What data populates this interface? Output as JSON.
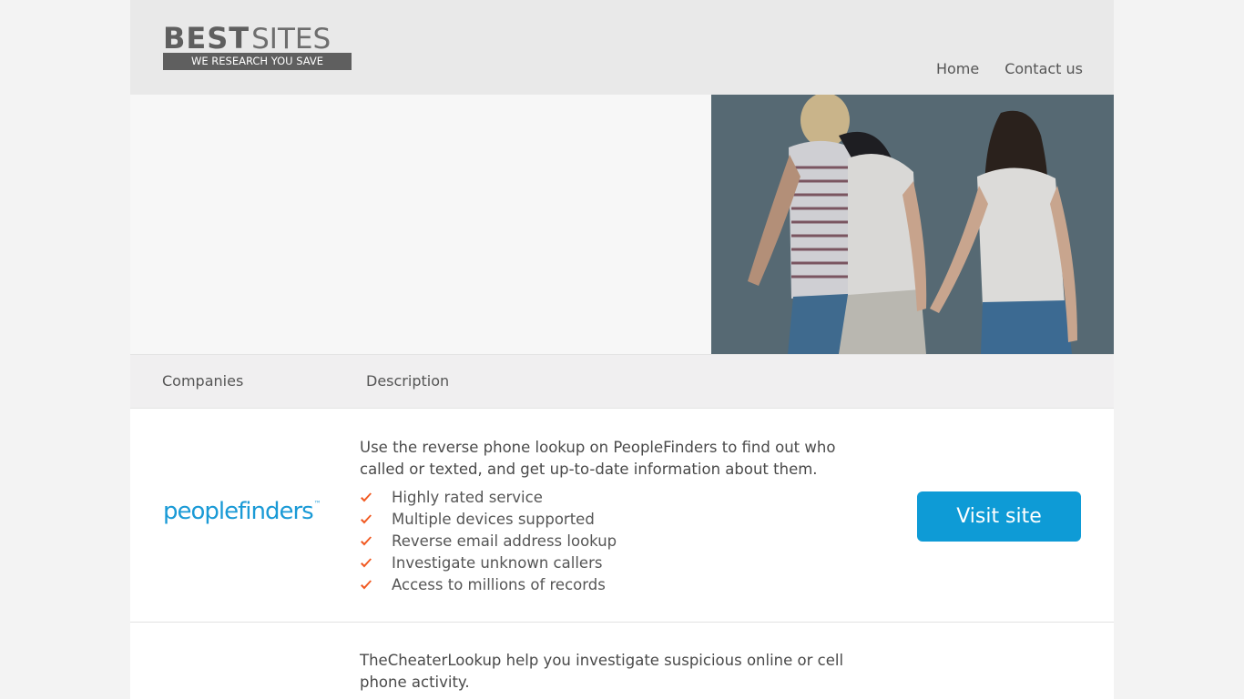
{
  "header": {
    "logo_bold": "BEST",
    "logo_light": "SITES",
    "logo_tagline": "WE RESEARCH YOU SAVE",
    "nav": {
      "home": "Home",
      "contact": "Contact us"
    }
  },
  "table": {
    "col_companies": "Companies",
    "col_description": "Description"
  },
  "rows": [
    {
      "company_logo_text": "peoplefinders",
      "company_logo_mark": "™",
      "description": "Use the reverse phone lookup on PeopleFinders to find out who called or texted, and get up-to-date information about them.",
      "features": [
        "Highly rated service",
        "Multiple devices supported",
        "Reverse email address lookup",
        "Investigate unknown callers",
        "Access to millions of records"
      ],
      "button_label": "Visit site"
    },
    {
      "description": "TheCheaterLookup help you investigate suspicious online or cell phone activity."
    }
  ],
  "colors": {
    "accent": "#0e9bd6",
    "check": "#f15a22",
    "header_bg": "#e9e9e9"
  },
  "icons": {
    "feature_bullet": "check-icon"
  }
}
